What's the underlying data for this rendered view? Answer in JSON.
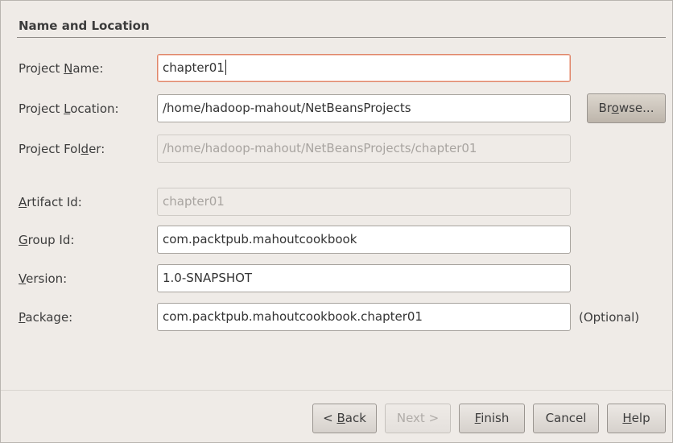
{
  "section": {
    "title": "Name and Location"
  },
  "fields": {
    "project_name": {
      "pre": "Project ",
      "mn": "N",
      "post": "ame:",
      "value": "chapter01"
    },
    "project_location": {
      "pre": "Project ",
      "mn": "L",
      "post": "ocation:",
      "value": "/home/hadoop-mahout/NetBeansProjects"
    },
    "project_folder": {
      "pre": "Project Fol",
      "mn": "d",
      "post": "er:",
      "value": "/home/hadoop-mahout/NetBeansProjects/chapter01"
    },
    "artifact_id": {
      "pre": "",
      "mn": "A",
      "post": "rtifact Id:",
      "value": "chapter01"
    },
    "group_id": {
      "pre": "",
      "mn": "G",
      "post": "roup Id:",
      "value": "com.packtpub.mahoutcookbook"
    },
    "version": {
      "pre": "",
      "mn": "V",
      "post": "ersion:",
      "value": "1.0-SNAPSHOT"
    },
    "package": {
      "pre": "",
      "mn": "P",
      "post": "ackage:",
      "value": "com.packtpub.mahoutcookbook.chapter01",
      "note": "(Optional)"
    }
  },
  "browse_button": {
    "pre": "Br",
    "mn": "o",
    "post": "wse..."
  },
  "footer": {
    "back": {
      "pre": "< ",
      "mn": "B",
      "post": "ack"
    },
    "next": {
      "label": "Next >"
    },
    "finish": {
      "pre": "",
      "mn": "F",
      "post": "inish"
    },
    "cancel": {
      "label": "Cancel"
    },
    "help": {
      "pre": "",
      "mn": "H",
      "post": "elp"
    }
  }
}
